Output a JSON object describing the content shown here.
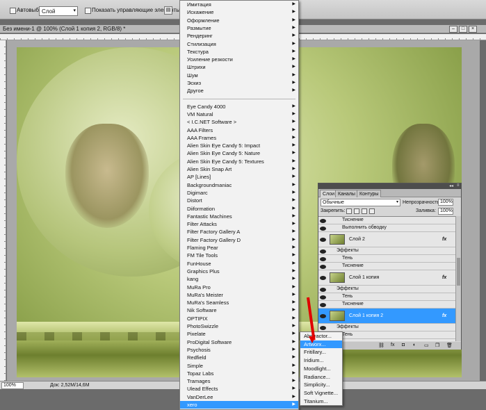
{
  "optionsBar": {
    "autoselect_label": "Автовыбор:",
    "autoselect_value": "Слой",
    "show_controls_label": "Показать управляющие элементы"
  },
  "document": {
    "title": "Без имени-1 @ 100% (Слой 1 копия 2, RGB/8) *",
    "zoom": "100%",
    "doc_info": "Док: 2,52M/14,6M"
  },
  "filterMenu": {
    "group1": [
      "Имитация",
      "Искажение",
      "Оформление",
      "Размытие",
      "Рендеринг",
      "Стилизация",
      "Текстура",
      "Усиление резкости",
      "Штрихи",
      "Шум",
      "Эскиз",
      "Другое"
    ],
    "group2": [
      "Eye Candy 4000",
      "VM Natural",
      "< I.C.NET Software >",
      "AAA Filters",
      "AAA Frames",
      "Alien Skin Eye Candy 5: Impact",
      "Alien Skin Eye Candy 5: Nature",
      "Alien Skin Eye Candy 5: Textures",
      "Alien Skin Snap Art",
      "AP [Lines]",
      "Backgroundmaniac",
      "Digimarc",
      "Distort",
      "Diiformation",
      "Fantastic Machines",
      "Filter Attacks",
      "Filter Factory Gallery A",
      "Filter Factory Gallery D",
      "Flaming Pear",
      "FM Tile Tools",
      "FunHouse",
      "Graphics Plus",
      "kang",
      "MuRa Pro",
      "MuRa's Meister",
      "MuRa's Seamless",
      "Nik Software",
      "OPTIPIX",
      "PhotoSwizzle",
      "Pixelate",
      "ProDigital Software",
      "Psychosis",
      "Redfield",
      "Simple",
      "Topaz Labs",
      "Tramages",
      "Ulead Effects",
      "VanDerLee",
      "xero"
    ],
    "highlighted": "xero"
  },
  "xeroSubmenu": {
    "items": [
      "Abstractor...",
      "Artworx...",
      "Fritillary...",
      "Iridium...",
      "Moodlight...",
      "Radiance...",
      "Simplicity...",
      "Soft Vignette...",
      "Titanium..."
    ],
    "highlighted": "Artworx..."
  },
  "layersPanel": {
    "tabs": [
      "Слои",
      "Каналы",
      "Контуры"
    ],
    "blend_mode": "Обычные",
    "opacity_label": "Непрозрачность:",
    "opacity_value": "100%",
    "lock_label": "Закрепить:",
    "fill_label": "Заливка:",
    "fill_value": "100%",
    "rows": {
      "r0": "Тиснение",
      "r1": "Выполнить обводку",
      "layer2": "Слой 2",
      "effects": "Эффекты",
      "shadow": "Тень",
      "emboss": "Тиснение",
      "layer1copy": "Слой 1 копия",
      "layer1copy2": "Слой 1 копия 2",
      "fx": "fx"
    }
  },
  "colors": {
    "highlight": "#3399ff",
    "arrow": "#e00000"
  }
}
